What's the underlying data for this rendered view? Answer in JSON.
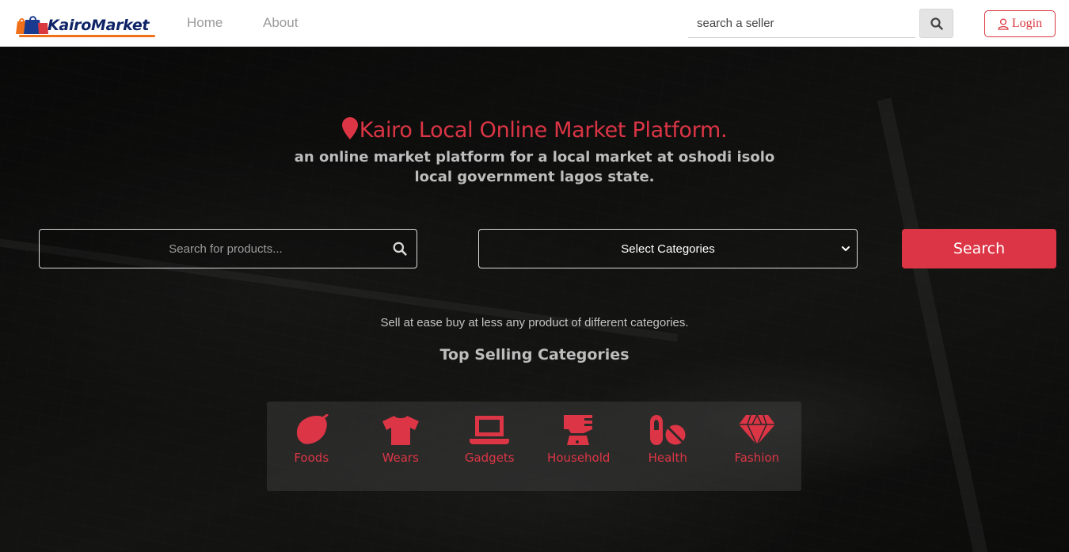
{
  "colors": {
    "accent": "#dc3545",
    "brand_navy": "#0f2466",
    "brand_orange": "#f0701a"
  },
  "navbar": {
    "brand_name": "KairoMarket",
    "links": [
      {
        "label": "Home"
      },
      {
        "label": "About"
      }
    ],
    "seller_search": {
      "placeholder": "search a seller",
      "icon": "search-icon"
    },
    "login": {
      "label": "Login",
      "icon": "user-icon"
    }
  },
  "hero": {
    "title": "Kairo Local Online Market Platform.",
    "title_icon": "map-pin-icon",
    "subtitle": "an online market platform for a local market at oshodi isolo local government lagos state.",
    "product_search": {
      "placeholder": "Search for products...",
      "icon": "search-icon"
    },
    "category_select": {
      "selected": "Select Categories"
    },
    "search_button": "Search",
    "tagline": "Sell at ease buy at less any product of different categories.",
    "top_categories_heading": "Top Selling Categories",
    "categories": [
      {
        "label": "Foods",
        "icon": "lemon-icon"
      },
      {
        "label": "Wears",
        "icon": "tshirt-icon"
      },
      {
        "label": "Gadgets",
        "icon": "laptop-icon"
      },
      {
        "label": "Household",
        "icon": "blender-icon"
      },
      {
        "label": "Health",
        "icon": "pills-icon"
      },
      {
        "label": "Fashion",
        "icon": "gem-icon"
      }
    ]
  }
}
